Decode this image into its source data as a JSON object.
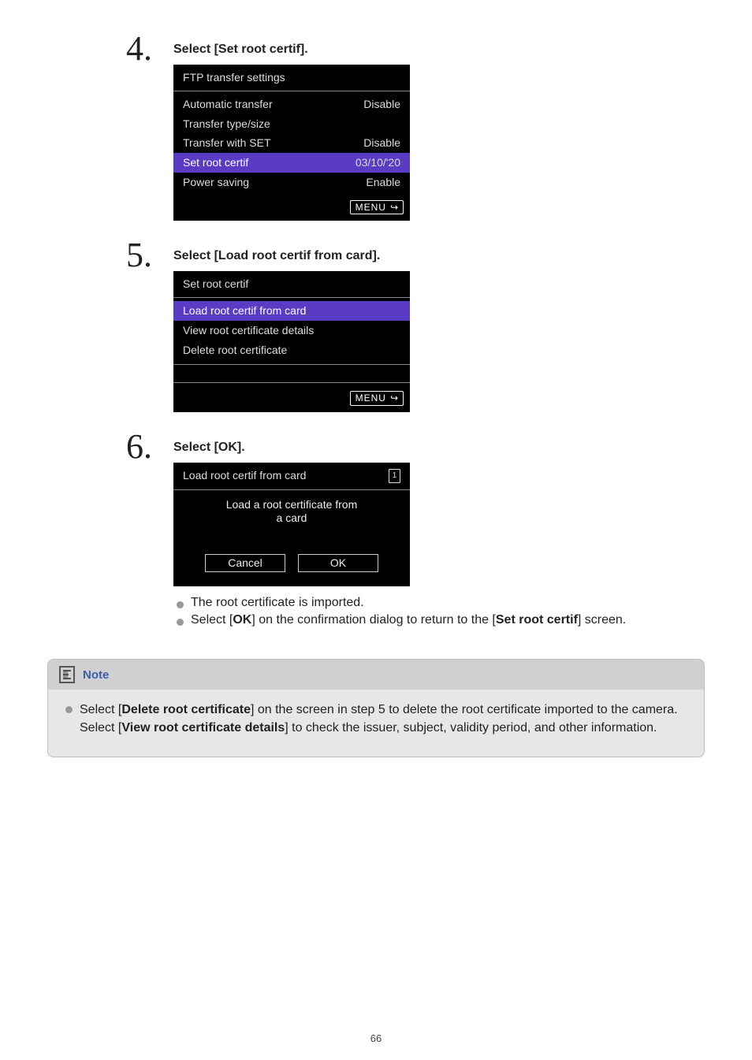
{
  "step4": {
    "num": "4.",
    "title": "Select [Set root certif].",
    "lcd": {
      "title": "FTP transfer settings",
      "rows": [
        {
          "label": "Automatic transfer",
          "value": "Disable",
          "hl": false
        },
        {
          "label": "Transfer type/size",
          "value": "",
          "hl": false
        },
        {
          "label": "Transfer with SET",
          "value": "Disable",
          "hl": false
        },
        {
          "label": "Set root certif",
          "value": "03/10/'20",
          "hl": true
        },
        {
          "label": "Power saving",
          "value": "Enable",
          "hl": false
        }
      ],
      "menu_label": "MENU"
    }
  },
  "step5": {
    "num": "5.",
    "title": "Select [Load root certif from card].",
    "lcd": {
      "title": "Set root certif",
      "rows": [
        {
          "label": "Load root certif from card",
          "hl": true
        },
        {
          "label": "View root certificate details",
          "hl": false
        },
        {
          "label": "Delete root certificate",
          "hl": false
        }
      ],
      "menu_label": "MENU"
    }
  },
  "step6": {
    "num": "6.",
    "title": "Select [OK].",
    "lcd": {
      "title": "Load root certif from card",
      "card_badge": "1",
      "msg_l1": "Load a root certificate from",
      "msg_l2": "a card",
      "cancel": "Cancel",
      "ok": "OK"
    },
    "bullets": [
      {
        "t1": "The root certificate is imported."
      },
      {
        "t1": "Select [",
        "bold1": "OK",
        "t2": "] on the confirmation dialog to return to the [",
        "bold2": "Set root certif",
        "t3": "] screen."
      }
    ]
  },
  "note": {
    "heading": "Note",
    "body": {
      "t1": "Select [",
      "bold1": "Delete root certificate",
      "t2": "] on the screen in step 5 to delete the root certificate imported to the camera. Select [",
      "bold2": "View root certificate details",
      "t3": "] to check the issuer, subject, validity period, and other information."
    }
  },
  "page_number": "66"
}
